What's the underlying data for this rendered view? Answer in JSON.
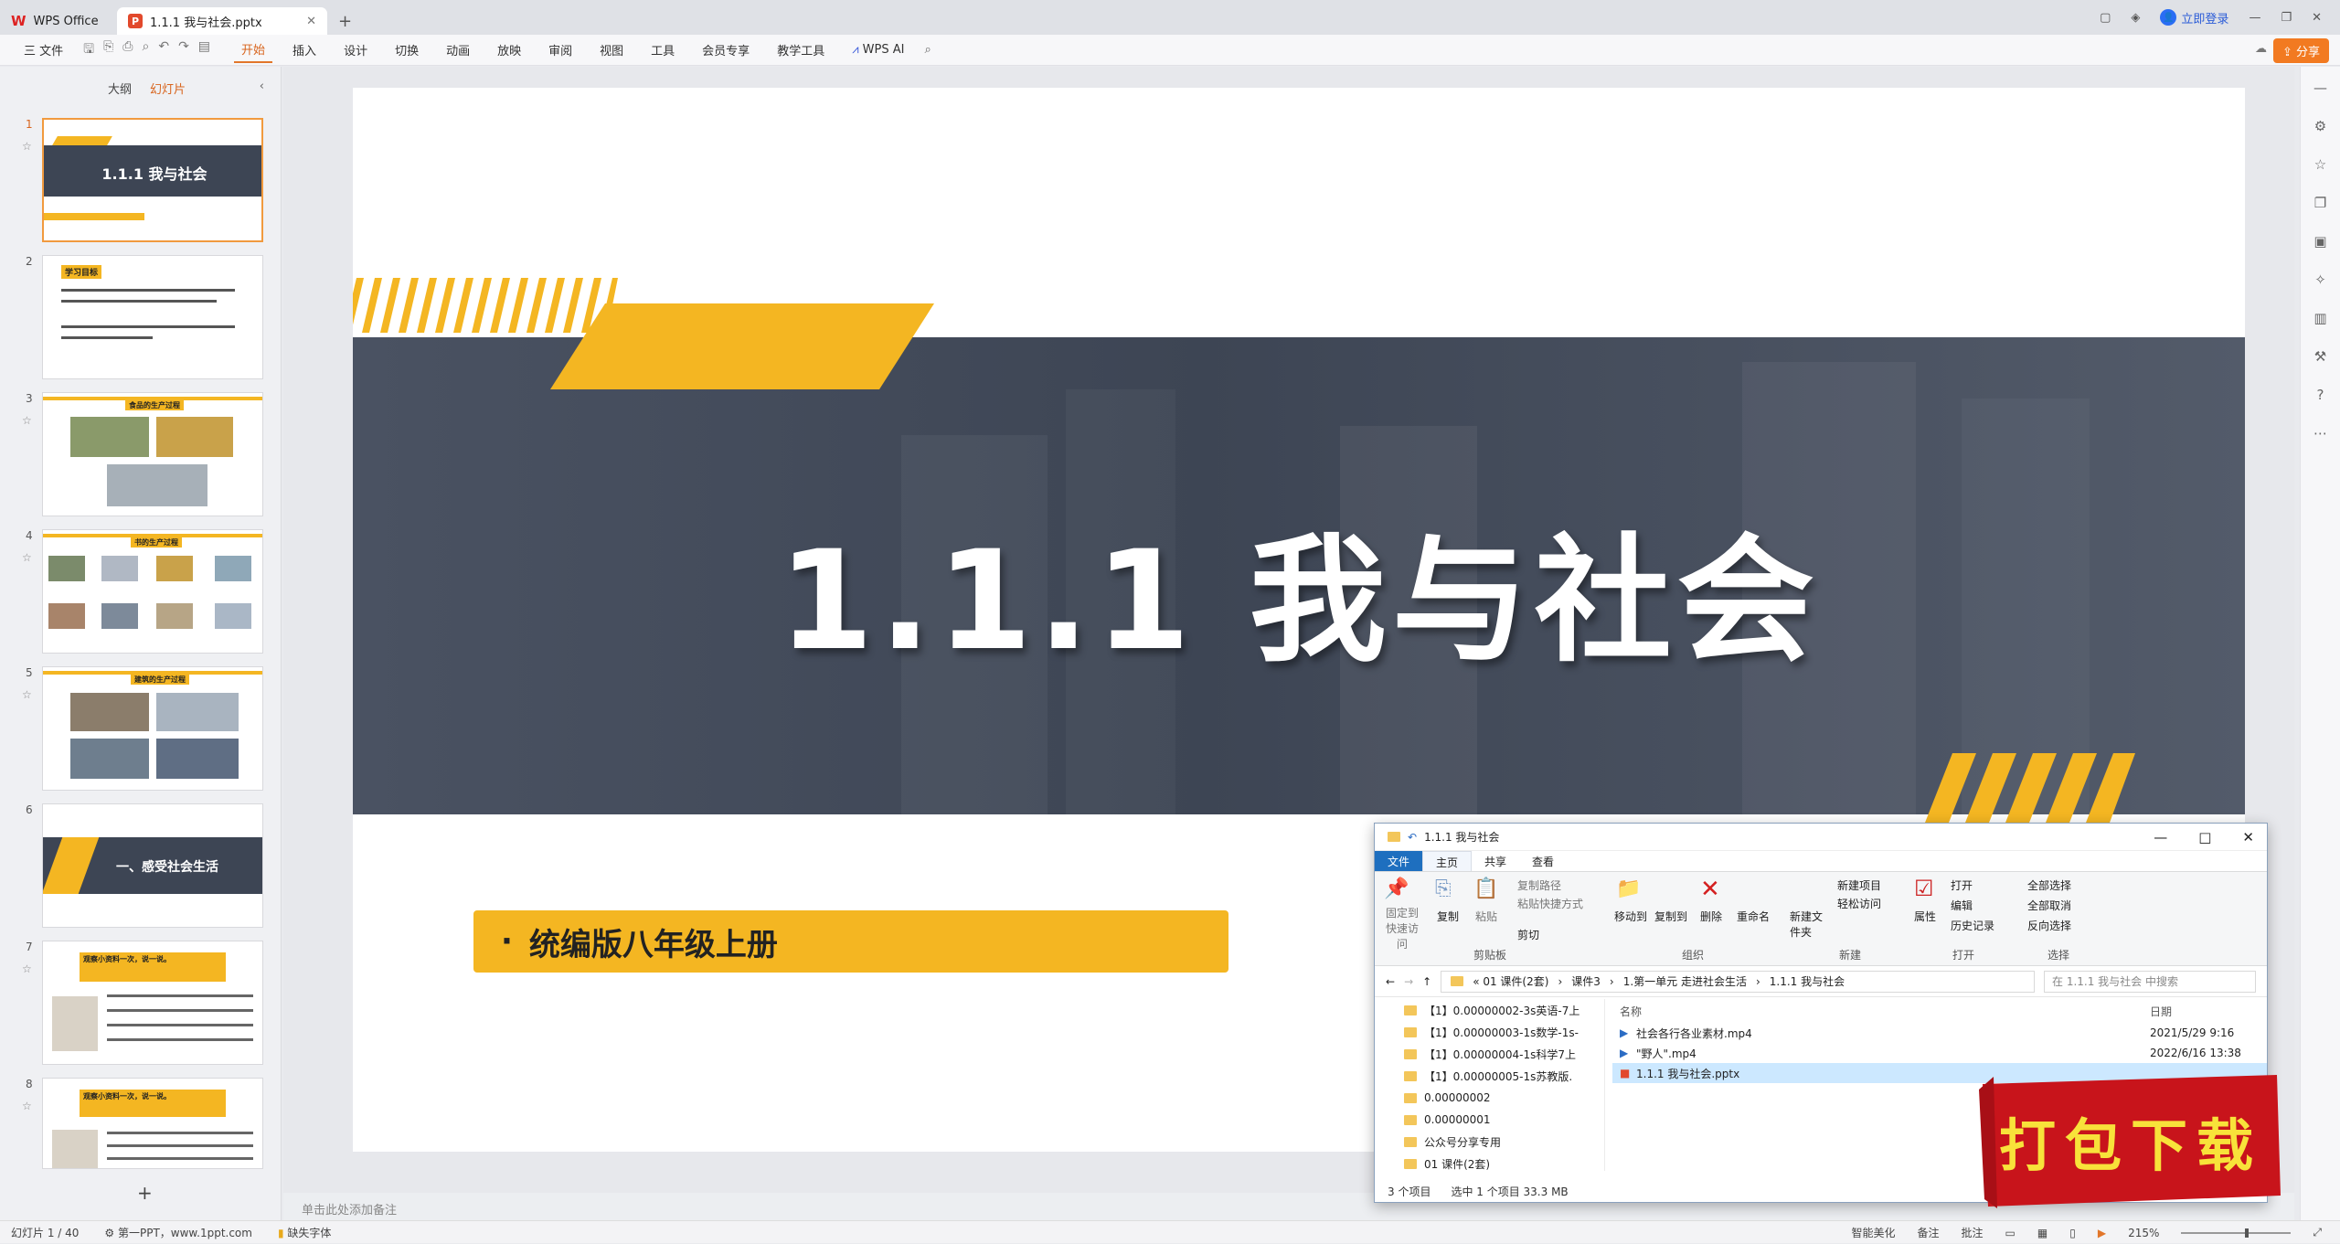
{
  "titlebar": {
    "home_tab": "WPS Office",
    "doc_tab": "1.1.1 我与社会.pptx",
    "login": "立即登录"
  },
  "ribbon": {
    "file_menu": "三 文件",
    "tabs": [
      "开始",
      "插入",
      "设计",
      "切换",
      "动画",
      "放映",
      "审阅",
      "视图",
      "工具",
      "会员专享",
      "教学工具"
    ],
    "active_tab": "开始",
    "ai": "WPS AI",
    "share": "分享"
  },
  "left_panel": {
    "tabs": [
      "大纲",
      "幻灯片"
    ],
    "active_tab": "幻灯片",
    "thumbnails": [
      {
        "num": "1",
        "title": "1.1.1 我与社会"
      },
      {
        "num": "2",
        "title": "学习目标"
      },
      {
        "num": "3",
        "title": "食品的生产过程"
      },
      {
        "num": "4",
        "title": "书的生产过程"
      },
      {
        "num": "5",
        "title": "建筑的生产过程"
      },
      {
        "num": "6",
        "title": "一、感受社会生活"
      },
      {
        "num": "7",
        "title": "观察小资料一次，说一说。"
      },
      {
        "num": "8",
        "title": "观察小资料一次，说一说。"
      }
    ]
  },
  "slide": {
    "title": "1.1.1  我与社会",
    "subtitle": "统编版八年级上册",
    "colors": {
      "band": "#3d4554",
      "accent": "#f4b622"
    }
  },
  "notes_placeholder": "单击此处添加备注",
  "statusbar": {
    "slide_count": "幻灯片 1 / 40",
    "theme": "第一PPT，www.1ppt.com",
    "missing_font": "缺失字体",
    "beautify": "智能美化",
    "notes": "备注",
    "comments": "批注",
    "zoom": "215%"
  },
  "explorer": {
    "title": "1.1.1 我与社会",
    "menu": [
      "文件",
      "主页",
      "共享",
      "查看"
    ],
    "ribbon_items": {
      "pin": "固定到快速访问",
      "copy": "复制",
      "paste": "粘贴",
      "copy_path": "复制路径",
      "paste_shortcut": "粘贴快捷方式",
      "cut": "剪切",
      "move_to": "移动到",
      "copy_to": "复制到",
      "delete": "删除",
      "rename": "重命名",
      "new_folder": "新建文件夹",
      "new_item": "新建项目",
      "easy_access": "轻松访问",
      "properties": "属性",
      "open": "打开",
      "edit": "编辑",
      "history": "历史记录",
      "select_all": "全部选择",
      "select_none": "全部取消",
      "invert": "反向选择"
    },
    "groups": [
      "剪贴板",
      "组织",
      "新建",
      "打开",
      "选择"
    ],
    "breadcrumb": [
      "« 01 课件(2套)",
      "课件3",
      "1.第一单元 走进社会生活",
      "1.1.1 我与社会"
    ],
    "search_placeholder": "在 1.1.1 我与社会 中搜索",
    "nav_items": [
      "【1】0.00000002-3s英语-7上",
      "【1】0.00000003-1s数学-1s-",
      "【1】0.00000004-1s科学7上",
      "【1】0.00000005-1s苏教版.",
      "0.00000002",
      "0.00000001",
      "公众号分享专用",
      "01 课件(2套)"
    ],
    "columns": {
      "name": "名称",
      "date": "日期"
    },
    "files": [
      {
        "name": "社会各行各业素材.mp4",
        "date": "2021/5/29 9:16"
      },
      {
        "name": "\"野人\".mp4",
        "date": "2022/6/16 13:38"
      },
      {
        "name": "1.1.1 我与社会.pptx",
        "date": ""
      }
    ],
    "status": {
      "count": "3 个项目",
      "selected": "选中 1 个项目  33.3 MB"
    }
  },
  "download_badge": "打包下载"
}
